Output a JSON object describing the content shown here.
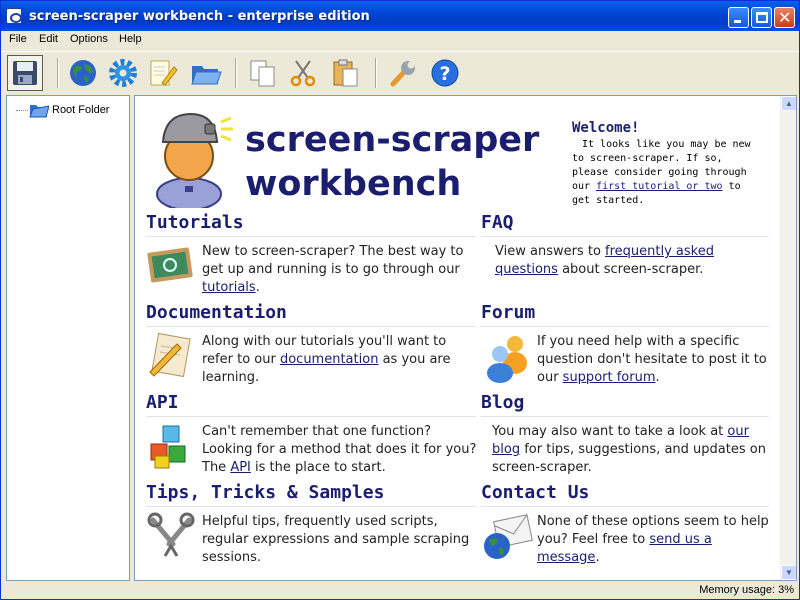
{
  "window": {
    "title": "screen-scraper workbench - enterprise edition"
  },
  "menu": {
    "file": "File",
    "edit": "Edit",
    "options": "Options",
    "help": "Help"
  },
  "toolbar": {
    "icons": [
      "save-icon",
      "globe-icon",
      "gear-icon",
      "pencil-icon",
      "folder-icon",
      "copy-icon",
      "cut-icon",
      "paste-icon",
      "wrench-icon",
      "help-icon"
    ]
  },
  "tree": {
    "root_label": "Root Folder"
  },
  "hero": {
    "title_line1": "screen-scraper",
    "title_line2": "workbench"
  },
  "welcome": {
    "heading": "Welcome!",
    "text_before": "It looks like you may be new to screen-scraper. If so, please consider going through our ",
    "link": "first tutorial or two",
    "text_after": " to get started."
  },
  "sections": {
    "tutorials": {
      "heading": "Tutorials",
      "before": "New to screen-scraper? The best way to get up and running is to go through our ",
      "link": "tutorials",
      "after": "."
    },
    "faq": {
      "heading": "FAQ",
      "before": "View answers to ",
      "link": "frequently asked questions",
      "after": " about screen-scraper."
    },
    "documentation": {
      "heading": "Documentation",
      "before": "Along with our tutorials you'll want to refer to our ",
      "link": "documentation",
      "after": " as you are learning."
    },
    "forum": {
      "heading": "Forum",
      "before": "If you need help with a specific question don't hesitate to post it to our ",
      "link": "support forum",
      "after": "."
    },
    "api": {
      "heading": "API",
      "before": "Can't remember that one function? Looking for a method that does it for you? The ",
      "link": "API",
      "after": " is the place to start."
    },
    "blog": {
      "heading": "Blog",
      "before": "You may also want to take a look at ",
      "link": "our blog",
      "after": " for tips, suggestions, and updates on screen-scraper."
    },
    "tips": {
      "heading": "Tips, Tricks & Samples",
      "text": "Helpful tips, frequently used scripts, regular expressions and sample scraping sessions."
    },
    "contact": {
      "heading": "Contact Us",
      "before": "None of these options seem to help you? Feel free to ",
      "link": "send us a message",
      "after": "."
    }
  },
  "status": {
    "memory": "Memory usage: 3%"
  },
  "colors": {
    "heading": "#1b1d6e",
    "titlebar": "#0046d5",
    "chrome": "#ece9d8"
  }
}
